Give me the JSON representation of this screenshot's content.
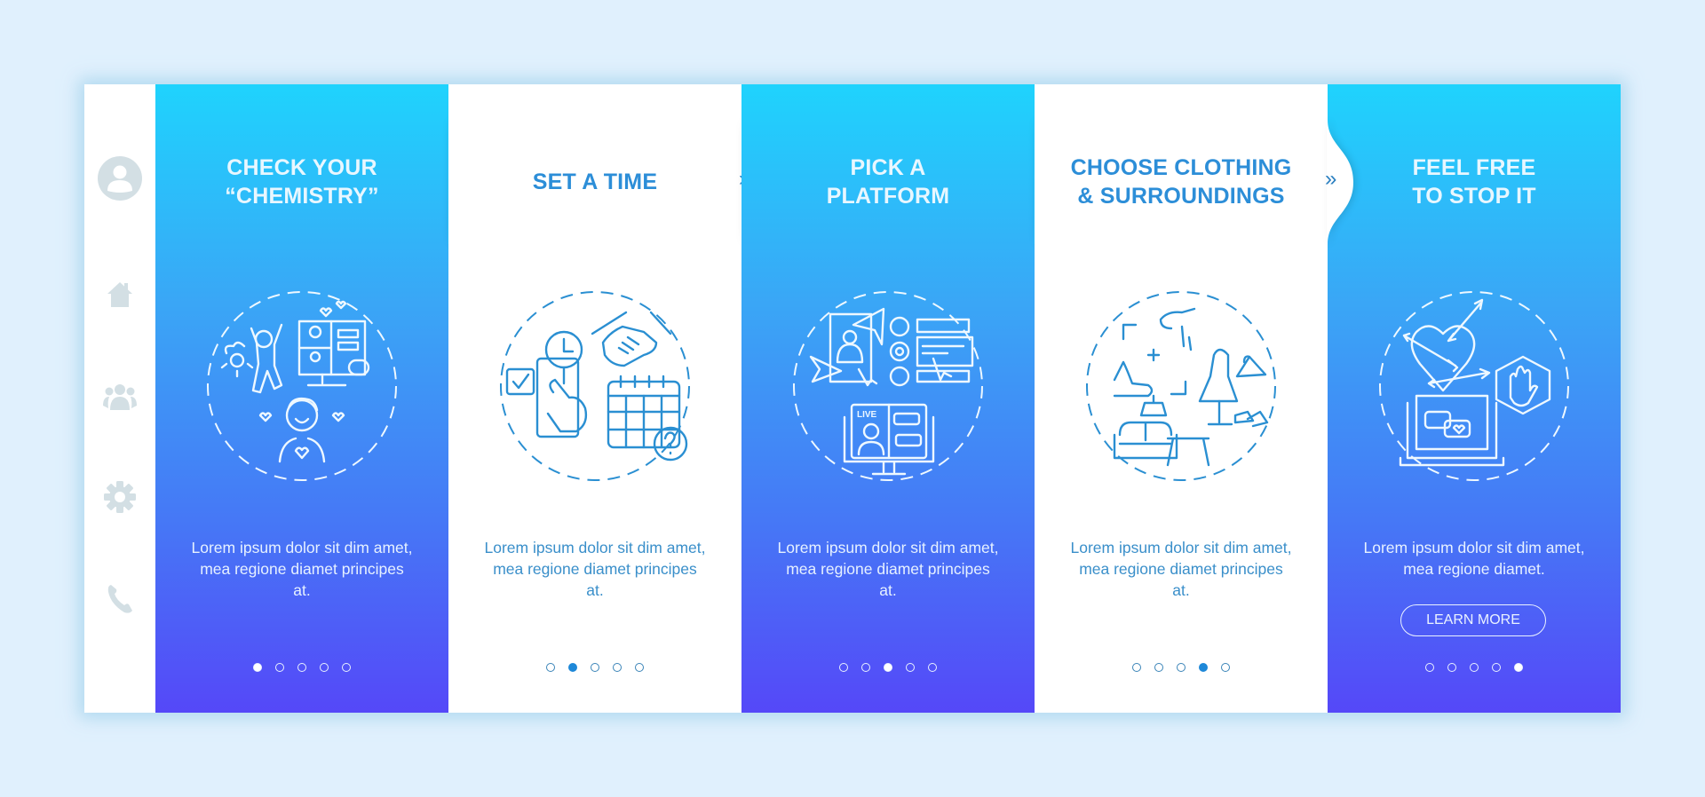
{
  "sidebar": {
    "items": [
      {
        "icon": "user-avatar-icon"
      },
      {
        "icon": "home-icon"
      },
      {
        "icon": "users-group-icon"
      },
      {
        "icon": "gear-icon"
      },
      {
        "icon": "phone-icon"
      }
    ]
  },
  "colors": {
    "page_background": "#e0f0fd",
    "gradient_top": "#1fd3fd",
    "gradient_bottom": "#5548f8",
    "white_panel_text": "#2c8ed8",
    "active_dot_blue_panel": "#ffffff",
    "active_dot_white_panel": "#1e88d8",
    "sidebar_icon": "#d0dde3"
  },
  "panels": [
    {
      "title": "CHECK YOUR\n“CHEMISTRY”",
      "illustration": "video-date-chemistry-icon",
      "description": "Lorem ipsum dolor sit dim amet, mea regione diamet principes at.",
      "active_page": 1,
      "next_arrow": "▸▸"
    },
    {
      "title": "SET A TIME",
      "illustration": "schedule-handshake-calendar-icon",
      "description": "Lorem ipsum dolor sit dim amet, mea regione diamet principes at.",
      "active_page": 2,
      "next_arrow": "»"
    },
    {
      "title": "PICK A\nPLATFORM",
      "illustration": "platform-live-stream-icon",
      "description": "Lorem ipsum dolor sit dim amet, mea regione diamet principes at.",
      "active_page": 3,
      "next_arrow": "▸▸"
    },
    {
      "title": "CHOOSE CLOTHING\n& SURROUNDINGS",
      "illustration": "clothing-furniture-frame-icon",
      "description": "Lorem ipsum dolor sit dim amet, mea regione diamet principes at.",
      "active_page": 4,
      "next_arrow": "»"
    },
    {
      "title": "FEEL FREE\nTO STOP IT",
      "illustration": "heart-arrows-stop-hand-icon",
      "description": "Lorem ipsum dolor sit dim amet, mea regione diamet.",
      "active_page": 5,
      "button_label": "LEARN MORE"
    }
  ],
  "pagination": {
    "total_pages": 5
  }
}
